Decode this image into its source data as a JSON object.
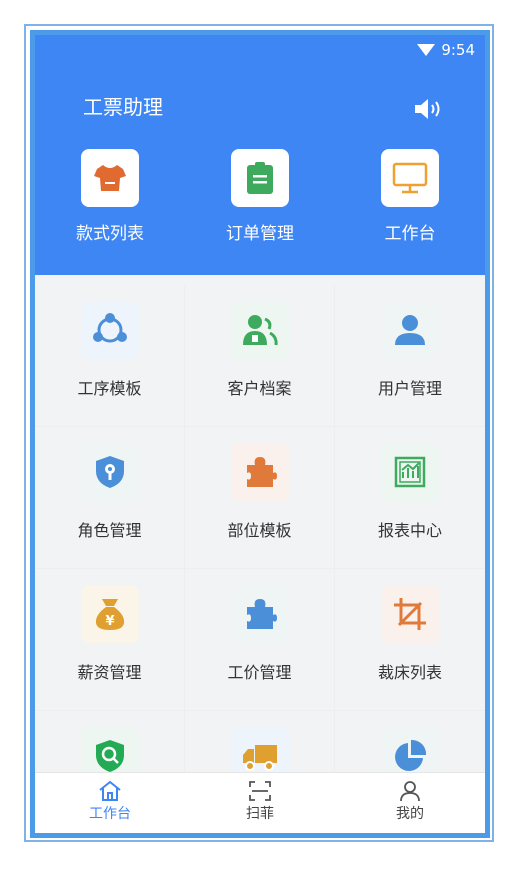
{
  "status_bar": {
    "time": "9:54"
  },
  "header": {
    "title": "工票助理",
    "sound_icon": "speaker-icon"
  },
  "quick_actions": [
    {
      "label": "款式列表",
      "icon": "shirt-icon",
      "color": "#e06a2f"
    },
    {
      "label": "订单管理",
      "icon": "clipboard-icon",
      "color": "#3daa5e"
    },
    {
      "label": "工作台",
      "icon": "monitor-icon",
      "color": "#f0a030"
    }
  ],
  "grid": [
    {
      "label": "工序模板",
      "icon": "process-icon",
      "color": "#4a8fd8"
    },
    {
      "label": "客户档案",
      "icon": "customers-icon",
      "color": "#3daa5e"
    },
    {
      "label": "用户管理",
      "icon": "user-icon",
      "color": "#4a8fd8"
    },
    {
      "label": "角色管理",
      "icon": "shield-key-icon",
      "color": "#4a8fd8"
    },
    {
      "label": "部位模板",
      "icon": "puzzle-icon",
      "color": "#e07a3a"
    },
    {
      "label": "报表中心",
      "icon": "report-icon",
      "color": "#3daa5e"
    },
    {
      "label": "薪资管理",
      "icon": "money-bag-icon",
      "color": "#e0a030"
    },
    {
      "label": "工价管理",
      "icon": "puzzle-icon",
      "color": "#4a8fd8"
    },
    {
      "label": "裁床列表",
      "icon": "crop-icon",
      "color": "#e07a3a"
    },
    {
      "label": "",
      "icon": "shield-search-icon",
      "color": "#22aa55"
    },
    {
      "label": "",
      "icon": "truck-icon",
      "color": "#e0a030"
    },
    {
      "label": "",
      "icon": "pie-chart-icon",
      "color": "#4a8fd8"
    }
  ],
  "tabbar": [
    {
      "label": "工作台",
      "icon": "home-icon",
      "active": true
    },
    {
      "label": "扫菲",
      "icon": "scan-icon",
      "active": false
    },
    {
      "label": "我的",
      "icon": "profile-icon",
      "active": false
    }
  ]
}
